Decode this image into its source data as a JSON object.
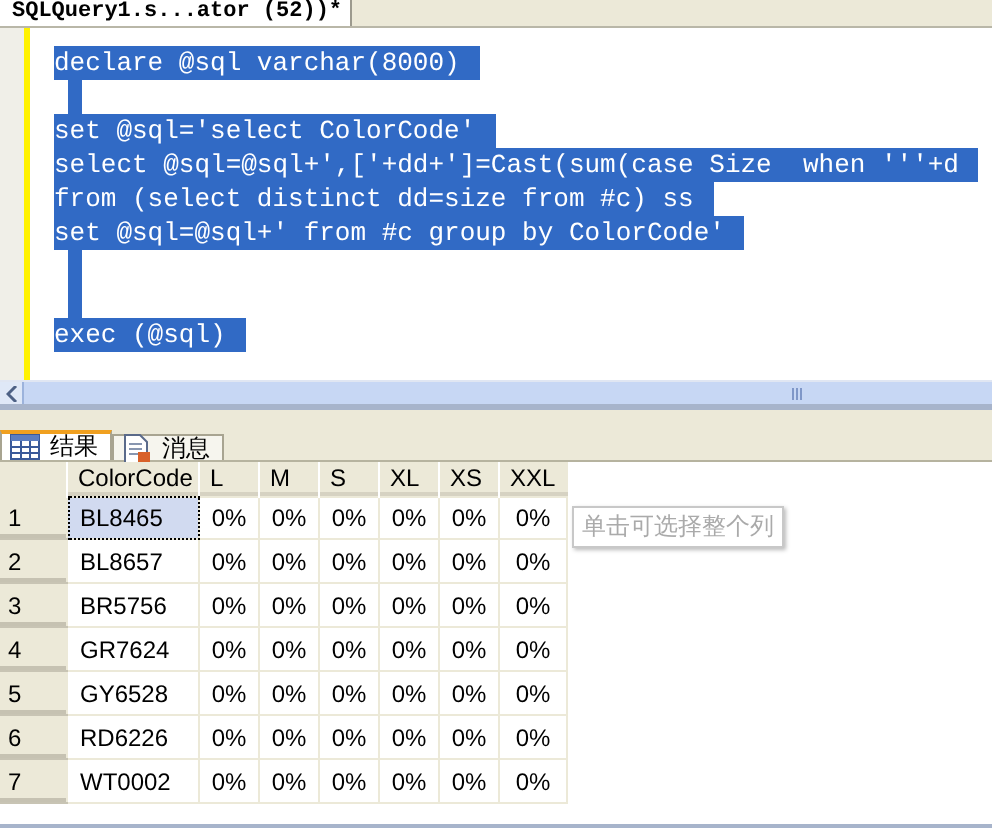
{
  "document_tab": {
    "title": "SQLQuery1.s...ator (52))*"
  },
  "editor": {
    "lines": [
      {
        "kind": "code",
        "text": "declare @sql varchar(8000)"
      },
      {
        "kind": "blank"
      },
      {
        "kind": "code",
        "text": "set @sql='select ColorCode'"
      },
      {
        "kind": "code",
        "text": "select @sql=@sql+',['+dd+']=Cast(sum(case Size  when '''+d"
      },
      {
        "kind": "code",
        "text": "from (select distinct dd=size from #c) ss"
      },
      {
        "kind": "code",
        "text": "set @sql=@sql+' from #c group by ColorCode'"
      },
      {
        "kind": "blank"
      },
      {
        "kind": "blank"
      },
      {
        "kind": "code",
        "text": "exec (@sql)"
      }
    ]
  },
  "result_tabs": [
    {
      "label": "结果",
      "kind": "grid",
      "selected": true
    },
    {
      "label": "消息",
      "kind": "messages",
      "selected": false
    }
  ],
  "grid": {
    "columns": [
      "ColorCode",
      "L",
      "M",
      "S",
      "XL",
      "XS",
      "XXL"
    ],
    "rows": [
      {
        "number": "1",
        "selected": true,
        "cells": [
          "BL8465",
          "0%",
          "0%",
          "0%",
          "0%",
          "0%",
          "0%"
        ]
      },
      {
        "number": "2",
        "selected": false,
        "cells": [
          "BL8657",
          "0%",
          "0%",
          "0%",
          "0%",
          "0%",
          "0%"
        ]
      },
      {
        "number": "3",
        "selected": false,
        "cells": [
          "BR5756",
          "0%",
          "0%",
          "0%",
          "0%",
          "0%",
          "0%"
        ]
      },
      {
        "number": "4",
        "selected": false,
        "cells": [
          "GR7624",
          "0%",
          "0%",
          "0%",
          "0%",
          "0%",
          "0%"
        ]
      },
      {
        "number": "5",
        "selected": false,
        "cells": [
          "GY6528",
          "0%",
          "0%",
          "0%",
          "0%",
          "0%",
          "0%"
        ]
      },
      {
        "number": "6",
        "selected": false,
        "cells": [
          "RD6226",
          "0%",
          "0%",
          "0%",
          "0%",
          "0%",
          "0%"
        ]
      },
      {
        "number": "7",
        "selected": false,
        "cells": [
          "WT0002",
          "0%",
          "0%",
          "0%",
          "0%",
          "0%",
          "0%"
        ]
      }
    ],
    "tooltip": "单击可选择整个列"
  }
}
